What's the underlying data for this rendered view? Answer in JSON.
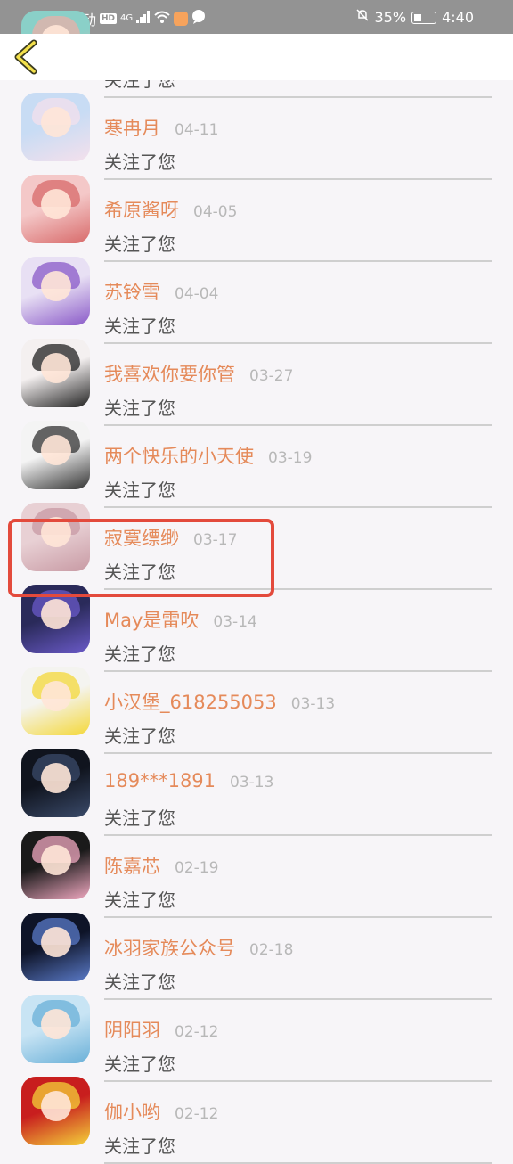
{
  "status_bar": {
    "carrier": "中国移动",
    "hd": "HD",
    "network": "4G",
    "battery": "35%",
    "time": "4:40"
  },
  "header": {
    "back_icon": "chevron-left-icon"
  },
  "colors": {
    "name": "#e58a5a",
    "date": "#b8b8b8",
    "highlight": "#e34a3c"
  },
  "list": [
    {
      "name": "",
      "date": "",
      "action": "关注了您",
      "avatar_colors": [
        "#8ad0c8",
        "#e8b0a8"
      ]
    },
    {
      "name": "寒冉月",
      "date": "04-11",
      "action": "关注了您",
      "avatar_colors": [
        "#c8dcf4",
        "#f4e0ec"
      ]
    },
    {
      "name": "希原酱呀",
      "date": "04-05",
      "action": "关注了您",
      "avatar_colors": [
        "#f4c8c8",
        "#d86a6a"
      ]
    },
    {
      "name": "苏铃雪",
      "date": "04-04",
      "action": "关注了您",
      "avatar_colors": [
        "#e8e0f4",
        "#8a5ac8"
      ]
    },
    {
      "name": "我喜欢你要你管",
      "date": "03-27",
      "action": "关注了您",
      "avatar_colors": [
        "#f4f0f0",
        "#222222"
      ]
    },
    {
      "name": "两个快乐的小天使",
      "date": "03-19",
      "action": "关注了您",
      "avatar_colors": [
        "#f4f4f4",
        "#333333"
      ]
    },
    {
      "name": "寂寞缥缈",
      "date": "03-17",
      "action": "关注了您",
      "avatar_colors": [
        "#e8d0d4",
        "#c89aa4"
      ]
    },
    {
      "name": "May是雷吹",
      "date": "03-14",
      "action": "关注了您",
      "avatar_colors": [
        "#2a2a5a",
        "#6a5ac8"
      ]
    },
    {
      "name": "小汉堡_618255053",
      "date": "03-13",
      "action": "关注了您",
      "avatar_colors": [
        "#f4f4f0",
        "#f4d83a"
      ]
    },
    {
      "name": "189***1891",
      "date": "03-13",
      "action": "关注了您",
      "avatar_colors": [
        "#10141e",
        "#3a4a6a"
      ]
    },
    {
      "name": "陈嘉芯",
      "date": "02-19",
      "action": "关注了您",
      "avatar_colors": [
        "#1a1a1a",
        "#f0a8c0"
      ]
    },
    {
      "name": "冰羽家族公众号",
      "date": "02-18",
      "action": "关注了您",
      "avatar_colors": [
        "#0e1428",
        "#5a7ac8"
      ]
    },
    {
      "name": "阴阳羽",
      "date": "02-12",
      "action": "关注了您",
      "avatar_colors": [
        "#c8e4f4",
        "#6ab0d8"
      ]
    },
    {
      "name": "伽小哟",
      "date": "02-12",
      "action": "关注了您",
      "avatar_colors": [
        "#c81e1e",
        "#f4d23a"
      ]
    }
  ]
}
